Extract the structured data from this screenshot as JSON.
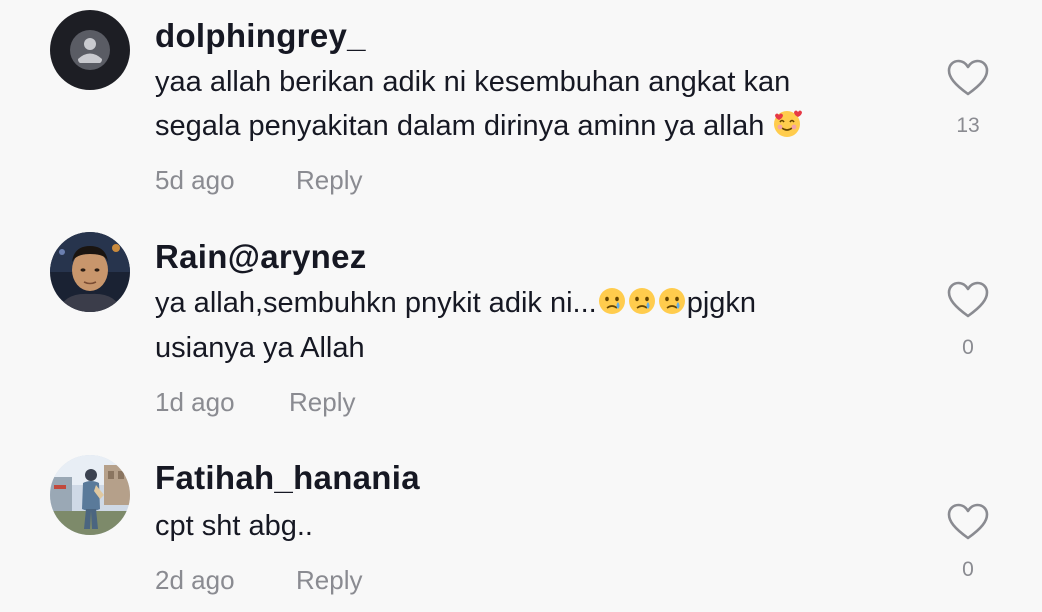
{
  "comments": [
    {
      "username": "dolphingrey_",
      "lines": [
        "yaa allah berikan adik ni kesembuhan angkat kan",
        "segala penyakitan dalam dirinya aminn ya allah"
      ],
      "line2_emoji": "smiling-face-with-hearts",
      "time": "5d ago",
      "reply": "Reply",
      "likes": "13"
    },
    {
      "username": "Rain@arynez",
      "line1_before": "ya allah,sembuhkn pnykit adik ni...",
      "line1_emojis": [
        "crying-face",
        "crying-face",
        "crying-face"
      ],
      "line1_after": "pjgkn",
      "line2": "usianya ya Allah",
      "time": "1d ago",
      "reply": "Reply",
      "likes": "0"
    },
    {
      "username": "Fatihah_hanania",
      "line1": "cpt sht abg..",
      "time": "2d ago",
      "reply": "Reply",
      "likes": "0"
    }
  ],
  "colors": {
    "background": "#f8f8f8",
    "username": "#161823",
    "text": "#161823",
    "meta": "#8a8b91",
    "heart_outline": "#8a8b91"
  }
}
